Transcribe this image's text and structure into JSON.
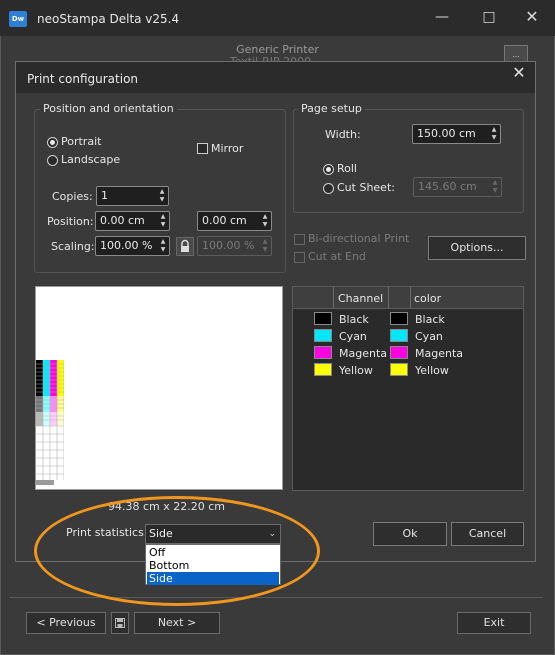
{
  "window": {
    "title": "neoStampa Delta  v25.4",
    "minimize_icon": "—",
    "maximize_icon": "□",
    "close_icon": "✕",
    "printer_name": "Generic Printer",
    "printer_line2": "Textil-RIP 2000 ...",
    "ghost_button": "..."
  },
  "dialog": {
    "title": "Print configuration",
    "close_icon": "✕",
    "position_group": {
      "legend": "Position and orientation",
      "portrait": "Portrait",
      "landscape": "Landscape",
      "mirror": "Mirror",
      "copies_label": "Copies:",
      "copies_value": "1",
      "position_label": "Position:",
      "position_x": "0.00 cm",
      "position_y": "0.00 cm",
      "scaling_label": "Scaling:",
      "scaling_x": "100.00 %",
      "scaling_y": "100.00 %",
      "orientation_selected": "Portrait"
    },
    "page_setup": {
      "legend": "Page setup",
      "width_label": "Width:",
      "width_value": "150.00 cm",
      "roll": "Roll",
      "cut_sheet": "Cut Sheet:",
      "cut_sheet_value": "145.60 cm",
      "media_selected": "Roll"
    },
    "bidirectional": "Bi-directional Print",
    "cut_at_end": "Cut at End",
    "options_button": "Options...",
    "channels": {
      "headers": [
        "Channel",
        "color"
      ],
      "rows": [
        {
          "channel": "Black",
          "color": "Black",
          "swatch": "#000000"
        },
        {
          "channel": "Cyan",
          "color": "Cyan",
          "swatch": "#00e8ff"
        },
        {
          "channel": "Magenta",
          "color": "Magenta",
          "swatch": "#ff00e0"
        },
        {
          "channel": "Yellow",
          "color": "Yellow",
          "swatch": "#ffff00"
        }
      ]
    },
    "dimensions": "94.38 cm x 22.20 cm",
    "print_statistics": {
      "label": "Print statistics:",
      "selected": "Side",
      "options": [
        "Off",
        "Bottom",
        "Side"
      ]
    },
    "ok_button": "Ok",
    "cancel_button": "Cancel"
  },
  "nav": {
    "previous": "<  Previous",
    "next": "Next  >",
    "exit": "Exit"
  },
  "colors": {
    "annotation": "#f0961e",
    "selection": "#0a64c8"
  }
}
